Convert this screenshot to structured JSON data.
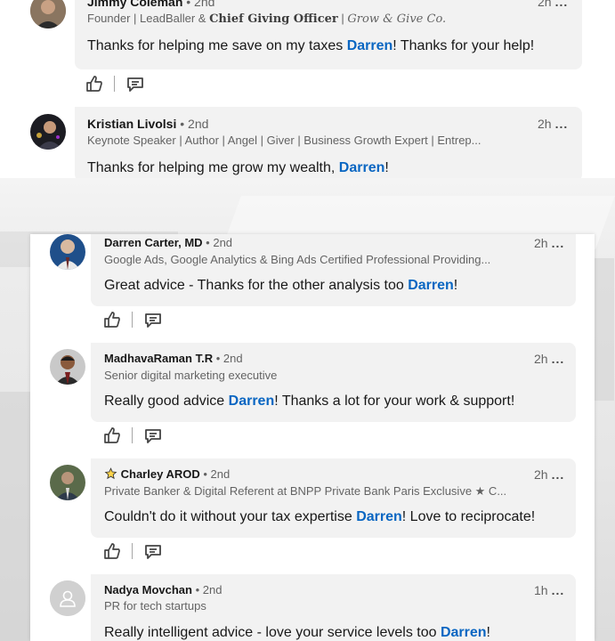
{
  "top_comments": [
    {
      "name": "Jimmy Coleman",
      "degree": "• 2nd",
      "headline_prefix": "Founder | LeadBaller & ",
      "headline_bold": "Chief Giving Officer",
      "headline_sep": " | ",
      "headline_italic": "Grow & Give Co.",
      "time": "2h",
      "more": "...",
      "text_before": "Thanks for helping me save on my taxes ",
      "mention": "Darren",
      "text_after": "! Thanks for your help!"
    },
    {
      "name": "Kristian Livolsi",
      "degree": "• 2nd",
      "headline": "Keynote Speaker | Author | Angel | Giver | Business Growth Expert | Entrep...",
      "time": "2h",
      "more": "...",
      "text_before": "Thanks for helping me grow my wealth, ",
      "mention": "Darren",
      "text_after": "!"
    }
  ],
  "bottom_comments": [
    {
      "name": "Darren Carter, MD",
      "degree": "• 2nd",
      "headline": "Google Ads, Google Analytics & Bing Ads Certified Professional Providing...",
      "time": "2h",
      "more": "...",
      "text_before": "Great advice - Thanks for the other analysis too ",
      "mention": "Darren",
      "text_after": "!"
    },
    {
      "name": "MadhavaRaman T.R",
      "degree": "• 2nd",
      "headline": "Senior digital marketing executive",
      "time": "2h",
      "more": "...",
      "text_before": "Really good advice ",
      "mention": "Darren",
      "text_after": "! Thanks a lot for your work & support!"
    },
    {
      "name": "Charley AROD",
      "name_prefix_icon": "star-icon",
      "degree": "• 2nd",
      "headline": "Private Banker & Digital Referent at BNPP Private Bank Paris Exclusive ★ C...",
      "time": "2h",
      "more": "...",
      "text_before": "Couldn't do it without your tax expertise ",
      "mention": "Darren",
      "text_after": "! Love to reciprocate!"
    },
    {
      "name": "Nadya Movchan",
      "degree": "• 2nd",
      "headline": "PR for tech startups",
      "time": "1h",
      "more": "...",
      "text_before": "Really intelligent advice - love your service levels too ",
      "mention": "Darren",
      "text_after": "!"
    }
  ],
  "icons": {
    "like": "thumbs-up-icon",
    "reply": "comment-icon",
    "placeholder_avatar": "person-icon"
  },
  "colors": {
    "mention": "#0a66c2",
    "bubble": "#f2f2f2"
  }
}
